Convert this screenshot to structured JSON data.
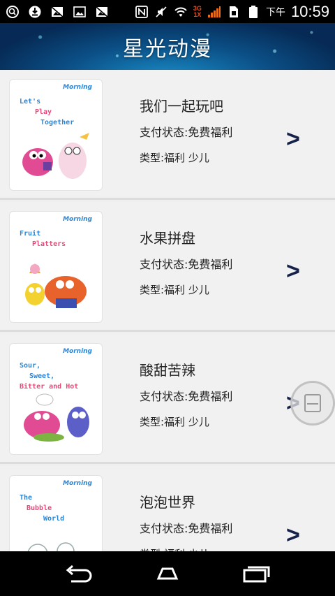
{
  "status_bar": {
    "icons": [
      "search-icon",
      "download-icon",
      "no-image-icon",
      "image-icon",
      "no-image-icon-2",
      "nfc-icon",
      "mute-icon",
      "wifi-icon",
      "signal-icon",
      "sim-icon",
      "battery-icon"
    ],
    "network_type": "3G",
    "network_sub": "1X",
    "ampm": "下午",
    "time": "10:59"
  },
  "header": {
    "title": "星光动漫"
  },
  "list": {
    "items": [
      {
        "title": "我们一起玩吧",
        "status": "支付状态:免费福利",
        "type": "类型:福利 少儿",
        "cover_brand": "Morning",
        "cover_title_a": "Let's",
        "cover_title_b": "Play",
        "cover_title_c": "Together"
      },
      {
        "title": "水果拼盘",
        "status": "支付状态:免费福利",
        "type": "类型:福利 少儿",
        "cover_brand": "Morning",
        "cover_title_a": "Fruit",
        "cover_title_b": "Platters",
        "cover_title_c": ""
      },
      {
        "title": "酸甜苦辣",
        "status": "支付状态:免费福利",
        "type": "类型:福利 少儿",
        "cover_brand": "Morning",
        "cover_title_a": "Sour,",
        "cover_title_b": "Sweet,",
        "cover_title_c": "Bitter and Hot"
      },
      {
        "title": "泡泡世界",
        "status": "支付状态:免费福利",
        "type": "类型:福利 少儿",
        "cover_brand": "Morning",
        "cover_title_a": "The",
        "cover_title_b": "Bubble",
        "cover_title_c": "World"
      }
    ],
    "chevron": ">"
  },
  "nav_bar": {
    "icons": [
      "back-icon",
      "home-icon",
      "recents-icon"
    ]
  },
  "colors": {
    "header_bg": "#0b4f86",
    "chevron": "#16214a",
    "list_bg": "#f1f1f1"
  }
}
